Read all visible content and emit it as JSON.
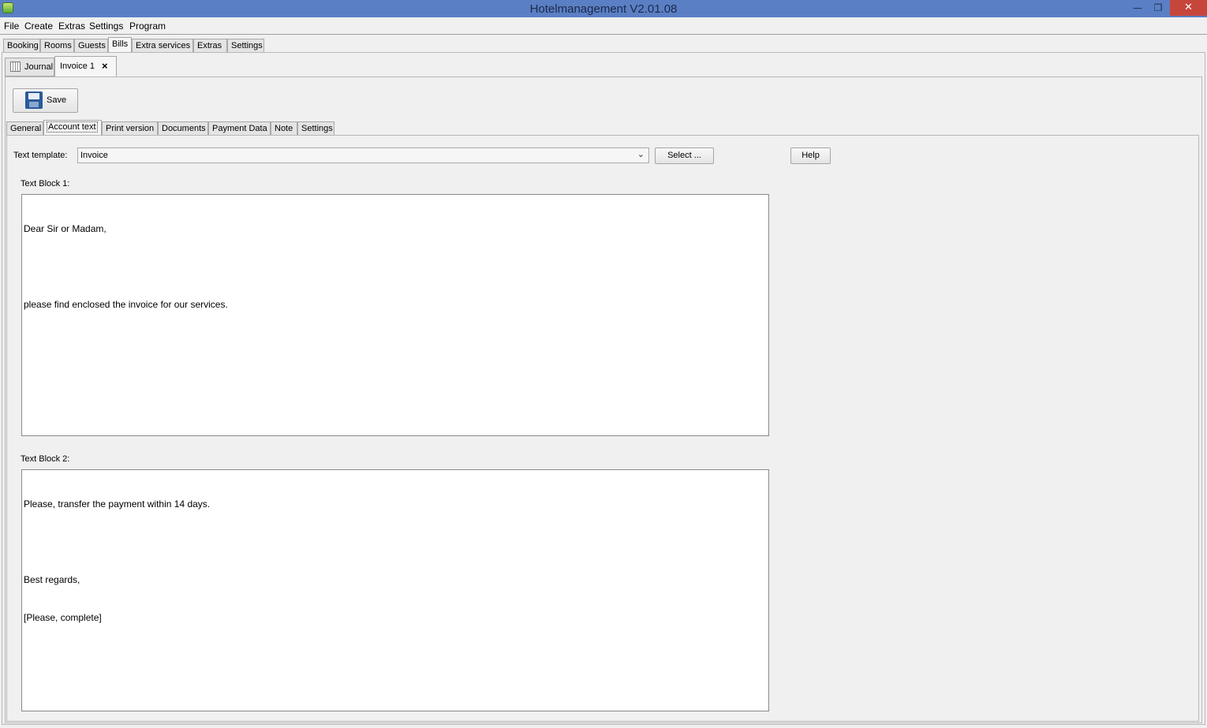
{
  "window": {
    "title": "Hotelmanagement V2.01.08",
    "min_icon": "minimize-icon",
    "max_icon": "restore-icon",
    "close_icon": "close-icon"
  },
  "menu": [
    "File",
    "Create",
    "Extras",
    "Settings",
    "Program"
  ],
  "main_tabs": [
    "Booking",
    "Rooms",
    "Guests",
    "Bills",
    "Extra services",
    "Extras",
    "Settings"
  ],
  "main_tabs_active": "Bills",
  "doc_tabs": {
    "journal": "Journal",
    "invoice": "Invoice 1",
    "close": "×"
  },
  "toolbar": {
    "save_label": "Save"
  },
  "sub_tabs": [
    "General",
    "Account text",
    "Print version",
    "Documents",
    "Payment Data",
    "Note",
    "Settings"
  ],
  "sub_tabs_active": "Account text",
  "account_text": {
    "template_label": "Text template:",
    "template_value": "Invoice",
    "select_button": "Select ...",
    "help_button": "Help",
    "block1_label": "Text Block 1:",
    "block1_lines": [
      "Dear Sir or Madam,",
      "",
      "please find enclosed the invoice for our services."
    ],
    "block2_label": "Text Block 2:",
    "block2_lines": [
      "Please, transfer the payment within 14 days.",
      "",
      "Best regards,",
      "[Please, complete]"
    ]
  }
}
